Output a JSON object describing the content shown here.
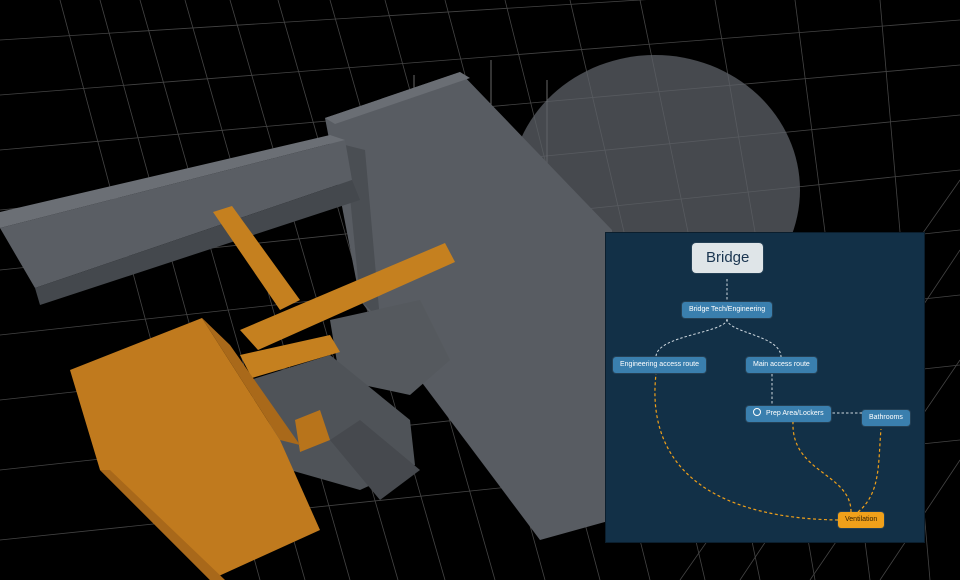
{
  "map": {
    "root": "Bridge",
    "nodes": {
      "bridge_tech": "Bridge Tech/Engineering",
      "engineering_access": "Engineering access route",
      "main_access": "Main access route",
      "prep_area": "Prep Area/Lockers",
      "bathrooms": "Bathrooms",
      "ventilation": "Ventilation"
    }
  },
  "colors": {
    "background": "#000000",
    "grid": "#8a8a8a",
    "structure_gray": "#55595e",
    "structure_orange": "#c07a1e",
    "panel_bg": "#123047",
    "node_blue": "#3a7fae",
    "ventilation_orange": "#f0a01a",
    "link_white": "#cfd8df"
  },
  "icons": {
    "prep_area": "ring-icon"
  }
}
